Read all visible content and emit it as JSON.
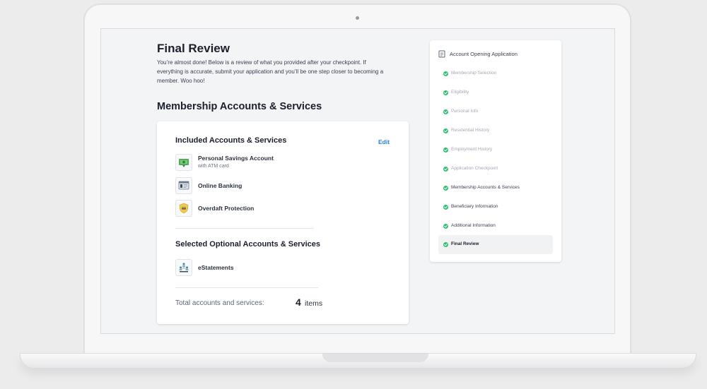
{
  "page": {
    "title": "Final Review",
    "intro": "You’re almost done! Below is a review of what you provided after your checkpoint. If everything is accurate, submit your application and you’ll be one step closer to becoming a member. Woo hoo!",
    "section_title": "Membership Accounts & Services"
  },
  "card": {
    "included_heading": "Included Accounts & Services",
    "edit_label": "Edit",
    "included_items": [
      {
        "name": "Personal Savings Account",
        "sub": "with ATM card",
        "icon": "savings-icon"
      },
      {
        "name": "Online Banking",
        "sub": "",
        "icon": "online-banking-icon"
      },
      {
        "name": "Overdaft Protection",
        "sub": "",
        "icon": "overdraft-shield-icon"
      }
    ],
    "optional_heading": "Selected Optional Accounts & Services",
    "optional_items": [
      {
        "name": "eStatements",
        "icon": "estatements-icon"
      }
    ],
    "total_label": "Total accounts and services:",
    "total_count": "4",
    "total_unit": "items"
  },
  "steps": {
    "title": "Account Opening Application",
    "items": [
      {
        "label": "Membership Selection",
        "state": "done-faint"
      },
      {
        "label": "Eligibility",
        "state": "done-faint"
      },
      {
        "label": "Personal Info",
        "state": "done-faint"
      },
      {
        "label": "Residential History",
        "state": "done-faint"
      },
      {
        "label": "Employment History",
        "state": "done-faint"
      },
      {
        "label": "Application Checkpoint",
        "state": "done-faint"
      },
      {
        "label": "Membership Accounts & Services",
        "state": "done"
      },
      {
        "label": "Beneficiary Information",
        "state": "done"
      },
      {
        "label": "Additional Information",
        "state": "done"
      },
      {
        "label": "Final Review",
        "state": "active"
      }
    ]
  },
  "colors": {
    "accent": "#2c7be5",
    "check": "#2fbf71"
  }
}
